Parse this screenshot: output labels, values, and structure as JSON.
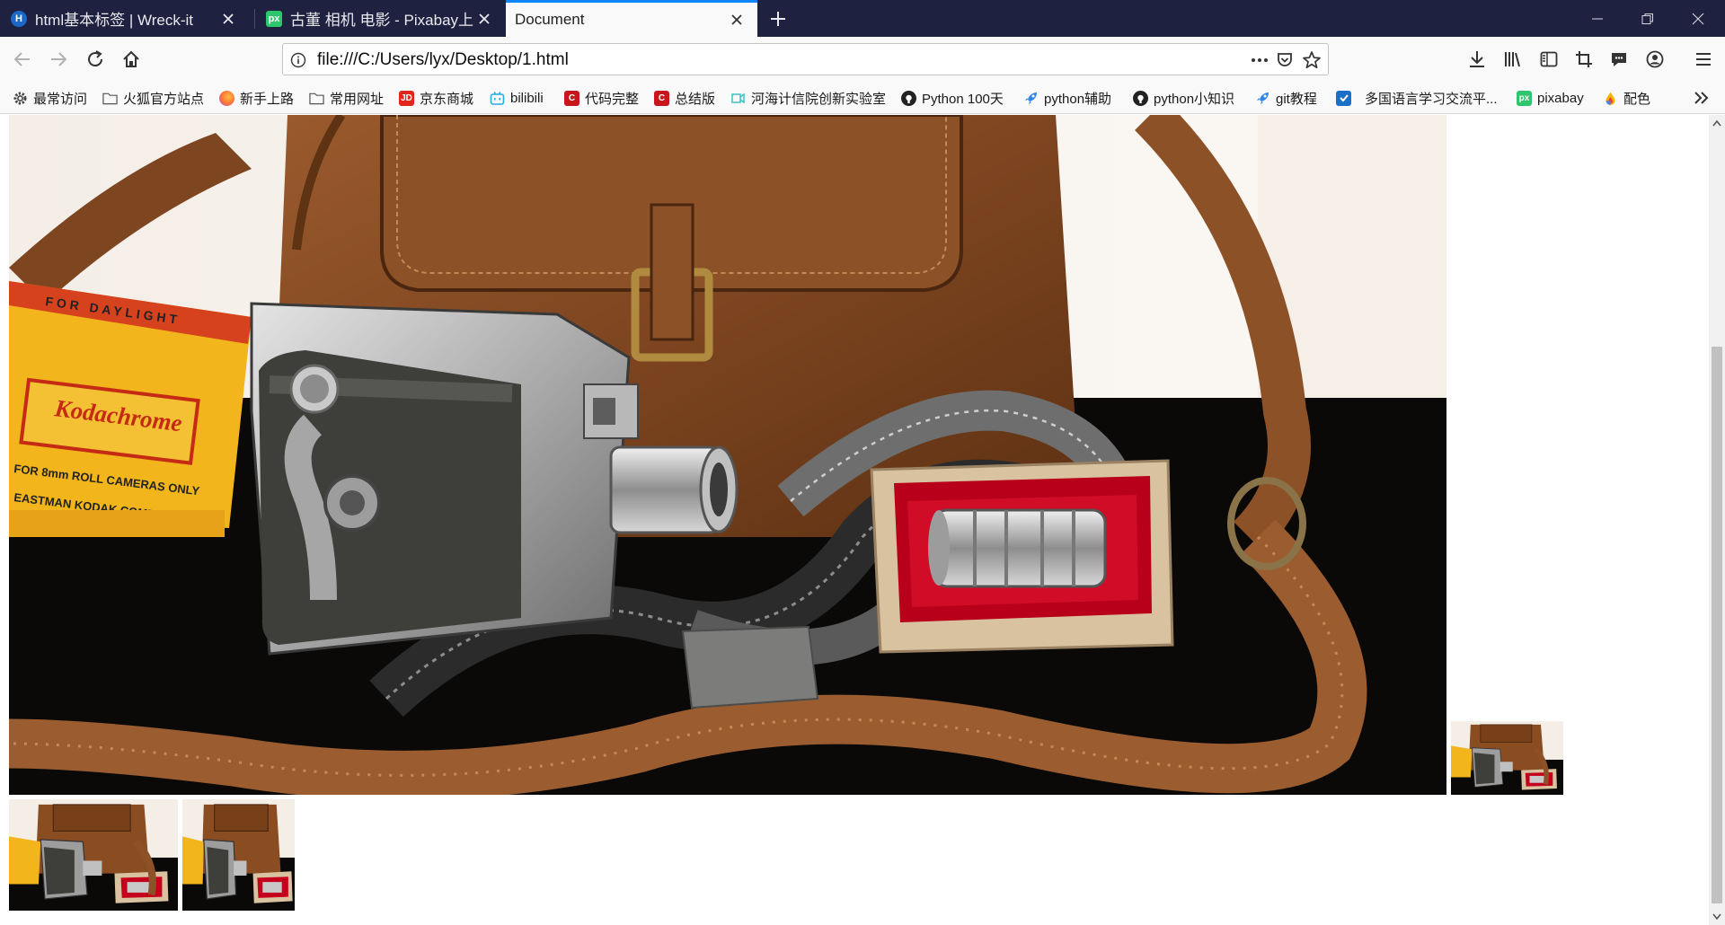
{
  "tabs": [
    {
      "title": "html基本标签 | Wreck-it",
      "favicon_text": "H",
      "favicon_color": "#1d68c7",
      "active": false
    },
    {
      "title": "古董 相机 电影 - Pixabay上的免费照片",
      "favicon_text": "px",
      "favicon_color": "#2ec66d",
      "active": false
    },
    {
      "title": "Document",
      "favicon_text": "",
      "favicon_color": "",
      "active": true
    }
  ],
  "toolbar": {
    "url": "file:///C:/Users/lyx/Desktop/1.html"
  },
  "bookmarks": [
    {
      "label": "最常访问",
      "icon": "gear-icon"
    },
    {
      "label": "火狐官方站点",
      "icon": "folder-icon"
    },
    {
      "label": "新手上路",
      "icon": "firefox-icon"
    },
    {
      "label": "常用网址",
      "icon": "folder-icon"
    },
    {
      "label": "京东商城",
      "icon": "jd-icon"
    },
    {
      "label": "bilibili",
      "icon": "bilibili-icon"
    },
    {
      "label": "代码完整",
      "icon": "c-icon"
    },
    {
      "label": "总结版",
      "icon": "c-icon"
    },
    {
      "label": "河海计信院创新实验室",
      "icon": "lab-icon"
    },
    {
      "label": "Python 100天",
      "icon": "github-icon"
    },
    {
      "label": "python辅助",
      "icon": "rocket-icon"
    },
    {
      "label": "python小知识",
      "icon": "github-icon"
    },
    {
      "label": "git教程",
      "icon": "rocket-icon"
    },
    {
      "label": "多国语言学习交流平...",
      "icon": "check-icon"
    },
    {
      "label": "pixabay",
      "icon": "pixabay-icon"
    },
    {
      "label": "配色",
      "icon": "palette-icon"
    }
  ],
  "colors": {
    "tabstrip": "#1e2140",
    "active_tab_accent": "#0a84ff",
    "toolbar_bg": "#f9f9fa"
  }
}
